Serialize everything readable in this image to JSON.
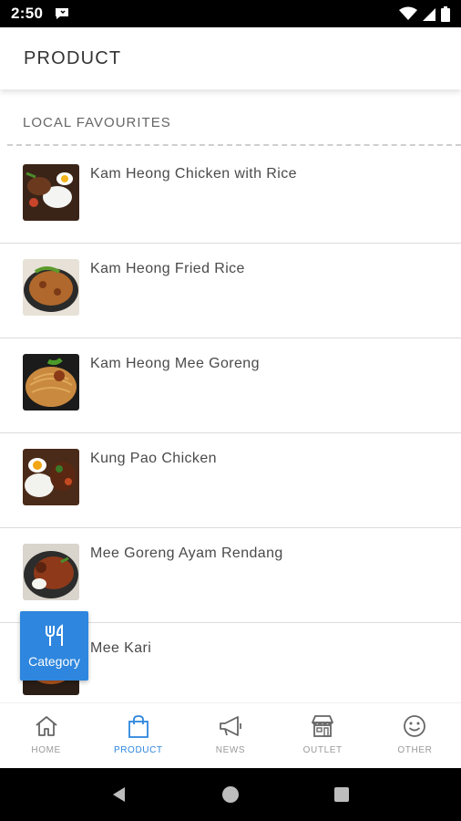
{
  "status_bar": {
    "time": "2:50"
  },
  "header": {
    "title": "PRODUCT"
  },
  "section": {
    "heading": "LOCAL FAVOURITES"
  },
  "products": [
    {
      "name": "Kam Heong Chicken with Rice"
    },
    {
      "name": "Kam Heong Fried Rice"
    },
    {
      "name": "Kam Heong Mee Goreng"
    },
    {
      "name": "Kung Pao Chicken"
    },
    {
      "name": "Mee Goreng Ayam Rendang"
    },
    {
      "name": "Mee Kari"
    }
  ],
  "category_button": {
    "label": "Category"
  },
  "bottom_nav": {
    "items": [
      {
        "label": "HOME",
        "icon": "home-icon"
      },
      {
        "label": "PRODUCT",
        "icon": "shopping-bag-icon",
        "active": true
      },
      {
        "label": "NEWS",
        "icon": "megaphone-icon"
      },
      {
        "label": "OUTLET",
        "icon": "store-icon"
      },
      {
        "label": "OTHER",
        "icon": "smiley-icon"
      }
    ]
  },
  "colors": {
    "accent": "#2e86de",
    "status_bar": "#000000",
    "text": "#4a4a4a"
  }
}
